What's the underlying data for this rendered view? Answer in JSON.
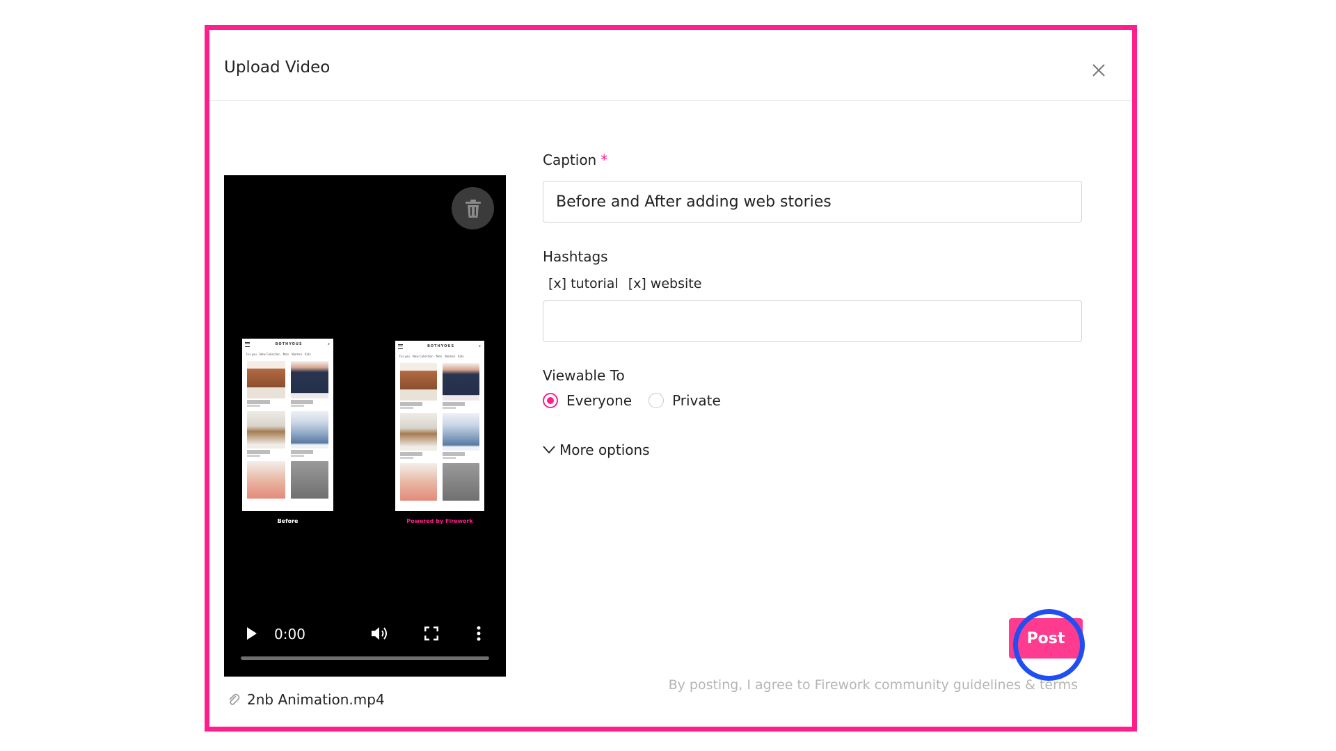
{
  "modal": {
    "title": "Upload Video",
    "close_icon": "close-icon"
  },
  "video": {
    "before_label": "Before",
    "after_label": "Powered by Firework",
    "brand": "BOTHYOUS",
    "phone_tabs": [
      "For you",
      "New Collection",
      "Men",
      "Women",
      "Kids"
    ],
    "time": "0:00",
    "progress": 0,
    "file_name": "2nb Animation.mp4"
  },
  "form": {
    "caption_label": "Caption",
    "caption_required": "*",
    "caption_value": "Before and After adding web stories",
    "hashtags_label": "Hashtags",
    "tags": [
      "[x] tutorial",
      "[x] website"
    ],
    "hashtag_value": "",
    "viewable_label": "Viewable To",
    "viewable_options": [
      {
        "label": "Everyone",
        "checked": true
      },
      {
        "label": "Private",
        "checked": false
      }
    ],
    "more_options": "More options",
    "post_label": "Post",
    "terms": "By posting, I agree to Firework community guidelines & terms"
  },
  "colors": {
    "accent": "#ff1e8c",
    "post_button": "#ff3b8f",
    "highlight": "#1f4ff0"
  }
}
